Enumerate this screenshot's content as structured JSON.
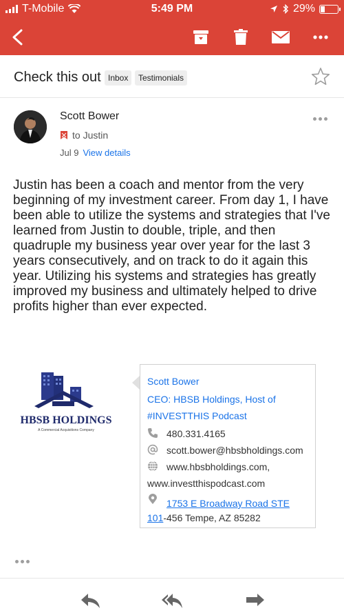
{
  "status_bar": {
    "carrier": "T-Mobile",
    "time": "5:49 PM",
    "battery": "29%"
  },
  "email": {
    "subject": "Check this out",
    "labels": [
      "Inbox",
      "Testimonials"
    ],
    "sender_name": "Scott Bower",
    "to_text": "to Justin",
    "date": "Jul 9",
    "view_details": "View details",
    "body": "Justin has been a coach and mentor from the very beginning of my investment career.  From day 1, I have been able to utilize the systems and strategies that I've learned from Justin to double, triple, and then quadruple my business year over year for the last 3 years consecutively, and on track to do it again this year.  Utilizing his systems and strategies has greatly improved my business and ultimately helped to drive profits higher than ever expected."
  },
  "signature": {
    "logo_text": "HBSB HOLDINGS",
    "logo_tagline": "A Commercial Acquisitions Company",
    "name": "Scott Bower",
    "title_line1": "CEO: HBSB Holdings, Host of",
    "title_line2": "#INVESTTHIS Podcast",
    "phone": "480.331.4165",
    "email": "scott.bower@hbsbholdings.com",
    "website1": "www.hbsbholdings.com,",
    "website2": "www.investthispodcast.com",
    "address_link1": "1753 E Broadway Road STE",
    "address_link2": "101",
    "address_rest": "-456 Tempe, AZ 85282"
  },
  "colors": {
    "appbar": "#db4437",
    "link": "#1a73e8"
  },
  "icons": {
    "back": "back-arrow-icon",
    "archive": "archive-icon",
    "delete": "trash-icon",
    "mail": "mail-icon",
    "more": "more-horizontal-icon",
    "star": "star-outline-icon",
    "reply": "reply-icon",
    "reply_all": "reply-all-icon",
    "forward": "forward-icon"
  }
}
